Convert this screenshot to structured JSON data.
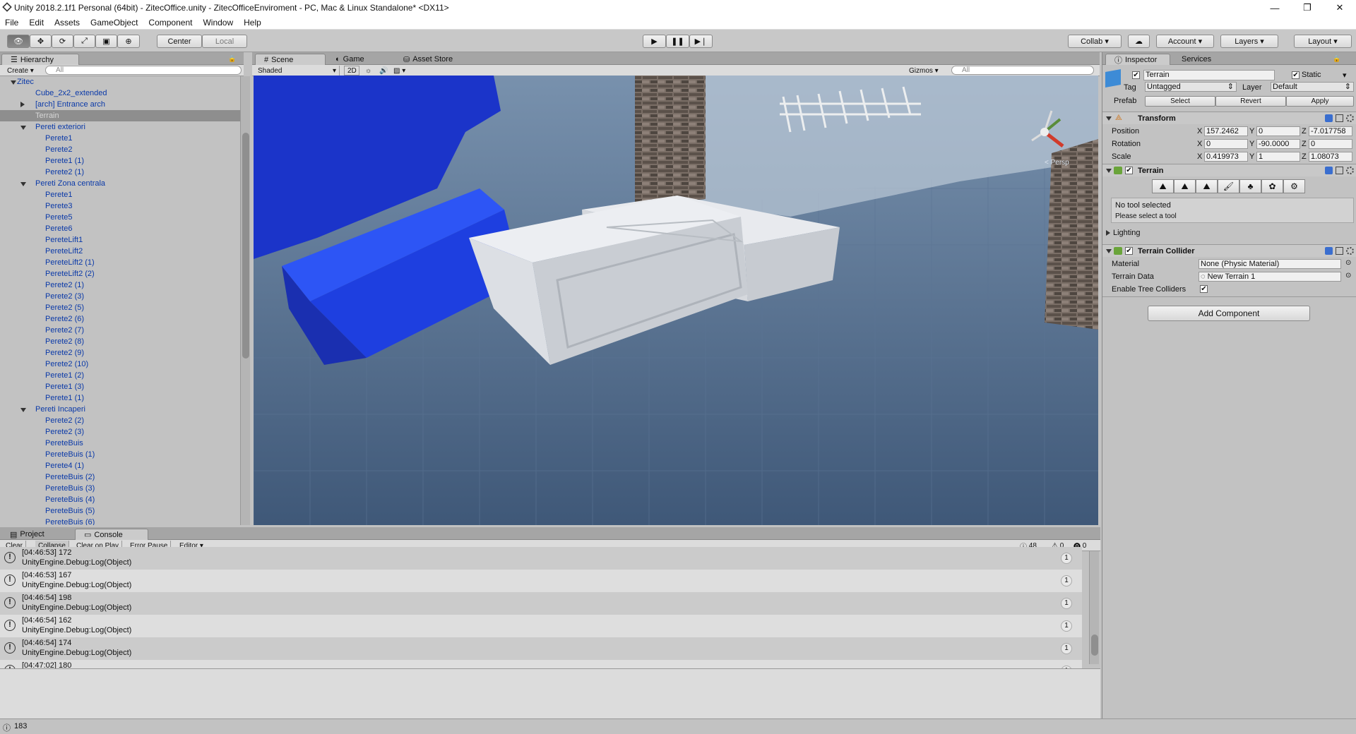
{
  "window": {
    "title": "Unity 2018.2.1f1 Personal (64bit) - ZitecOffice.unity - ZitecOfficeEnviroment - PC, Mac & Linux Standalone* <DX11>",
    "minimize": "—",
    "maximize": "❐",
    "close": "✕"
  },
  "menu": [
    "File",
    "Edit",
    "Assets",
    "GameObject",
    "Component",
    "Window",
    "Help"
  ],
  "toolbar": {
    "pivot": "Center",
    "space": "Local",
    "collab": "Collab",
    "account": "Account",
    "layers": "Layers",
    "layout": "Layout"
  },
  "hierarchy": {
    "tab": "Hierarchy",
    "create": "Create",
    "search_placeholder": "All",
    "rows": [
      {
        "label": "Zitec",
        "indent": 0,
        "arrow": "down"
      },
      {
        "label": "Cube_2x2_extended",
        "indent": 1,
        "arrow": ""
      },
      {
        "label": "[arch] Entrance arch",
        "indent": 1,
        "arrow": "right"
      },
      {
        "label": "Terrain",
        "indent": 1,
        "arrow": "",
        "selected": true
      },
      {
        "label": "Pereti exteriori",
        "indent": 1,
        "arrow": "down"
      },
      {
        "label": "Perete1",
        "indent": 2,
        "arrow": ""
      },
      {
        "label": "Perete2",
        "indent": 2,
        "arrow": ""
      },
      {
        "label": "Perete1 (1)",
        "indent": 2,
        "arrow": ""
      },
      {
        "label": "Perete2 (1)",
        "indent": 2,
        "arrow": ""
      },
      {
        "label": "Pereti Zona centrala",
        "indent": 1,
        "arrow": "down"
      },
      {
        "label": "Perete1",
        "indent": 2,
        "arrow": ""
      },
      {
        "label": "Perete3",
        "indent": 2,
        "arrow": ""
      },
      {
        "label": "Perete5",
        "indent": 2,
        "arrow": ""
      },
      {
        "label": "Perete6",
        "indent": 2,
        "arrow": ""
      },
      {
        "label": "PereteLift1",
        "indent": 2,
        "arrow": ""
      },
      {
        "label": "PereteLift2",
        "indent": 2,
        "arrow": ""
      },
      {
        "label": "PereteLift2 (1)",
        "indent": 2,
        "arrow": ""
      },
      {
        "label": "PereteLift2 (2)",
        "indent": 2,
        "arrow": ""
      },
      {
        "label": "Perete2 (1)",
        "indent": 2,
        "arrow": ""
      },
      {
        "label": "Perete2 (3)",
        "indent": 2,
        "arrow": ""
      },
      {
        "label": "Perete2 (5)",
        "indent": 2,
        "arrow": ""
      },
      {
        "label": "Perete2 (6)",
        "indent": 2,
        "arrow": ""
      },
      {
        "label": "Perete2 (7)",
        "indent": 2,
        "arrow": ""
      },
      {
        "label": "Perete2 (8)",
        "indent": 2,
        "arrow": ""
      },
      {
        "label": "Perete2 (9)",
        "indent": 2,
        "arrow": ""
      },
      {
        "label": "Perete2 (10)",
        "indent": 2,
        "arrow": ""
      },
      {
        "label": "Perete1 (2)",
        "indent": 2,
        "arrow": ""
      },
      {
        "label": "Perete1 (3)",
        "indent": 2,
        "arrow": ""
      },
      {
        "label": "Perete1 (1)",
        "indent": 2,
        "arrow": ""
      },
      {
        "label": "Pereti Incaperi",
        "indent": 1,
        "arrow": "down"
      },
      {
        "label": "Perete2 (2)",
        "indent": 2,
        "arrow": ""
      },
      {
        "label": "Perete2 (3)",
        "indent": 2,
        "arrow": ""
      },
      {
        "label": "PereteBuis",
        "indent": 2,
        "arrow": ""
      },
      {
        "label": "PereteBuis (1)",
        "indent": 2,
        "arrow": ""
      },
      {
        "label": "Perete4 (1)",
        "indent": 2,
        "arrow": ""
      },
      {
        "label": "PereteBuis (2)",
        "indent": 2,
        "arrow": ""
      },
      {
        "label": "PereteBuis (3)",
        "indent": 2,
        "arrow": ""
      },
      {
        "label": "PereteBuis (4)",
        "indent": 2,
        "arrow": ""
      },
      {
        "label": "PereteBuis (5)",
        "indent": 2,
        "arrow": ""
      },
      {
        "label": "PereteBuis (6)",
        "indent": 2,
        "arrow": ""
      }
    ]
  },
  "scene": {
    "tabs": [
      "Scene",
      "Game",
      "Asset Store"
    ],
    "shading": "Shaded",
    "mode2d": "2D",
    "gizmos": "Gizmos",
    "search_placeholder": "All",
    "persp": "< Persp"
  },
  "inspector": {
    "tabs": [
      "Inspector",
      "Services"
    ],
    "name": "Terrain",
    "static": "Static",
    "tag_label": "Tag",
    "tag": "Untagged",
    "layer_label": "Layer",
    "layer": "Default",
    "prefab_label": "Prefab",
    "prefab_buttons": [
      "Select",
      "Revert",
      "Apply"
    ],
    "transform": {
      "title": "Transform",
      "rows": [
        {
          "label": "Position",
          "x": "157.2462",
          "y": "0",
          "z": "-7.017758"
        },
        {
          "label": "Rotation",
          "x": "0",
          "y": "-90.0000",
          "z": "0"
        },
        {
          "label": "Scale",
          "x": "0.419973",
          "y": "1",
          "z": "1.08073"
        }
      ]
    },
    "terrain": {
      "title": "Terrain",
      "help1": "No tool selected",
      "help2": "Please select a tool",
      "lighting": "Lighting"
    },
    "collider": {
      "title": "Terrain Collider",
      "material_label": "Material",
      "material": "None (Physic Material)",
      "data_label": "Terrain Data",
      "data": "New Terrain 1",
      "trees_label": "Enable Tree Colliders"
    },
    "add_component": "Add Component"
  },
  "console": {
    "tabs": [
      "Project",
      "Console"
    ],
    "buttons": [
      "Clear",
      "Collapse",
      "Clear on Play",
      "Error Pause",
      "Editor"
    ],
    "counts": {
      "warn": "48",
      "error": "0",
      "info": "0"
    },
    "rows": [
      {
        "line1": "[04:46:53] 172",
        "line2": "UnityEngine.Debug:Log(Object)",
        "count": "1"
      },
      {
        "line1": "[04:46:53] 167",
        "line2": "UnityEngine.Debug:Log(Object)",
        "count": "1"
      },
      {
        "line1": "[04:46:54] 198",
        "line2": "UnityEngine.Debug:Log(Object)",
        "count": "1"
      },
      {
        "line1": "[04:46:54] 162",
        "line2": "UnityEngine.Debug:Log(Object)",
        "count": "1"
      },
      {
        "line1": "[04:46:54] 174",
        "line2": "UnityEngine.Debug:Log(Object)",
        "count": "1"
      },
      {
        "line1": "[04:47:02] 180",
        "line2": "",
        "count": "1"
      }
    ]
  },
  "status": {
    "text": "183"
  }
}
